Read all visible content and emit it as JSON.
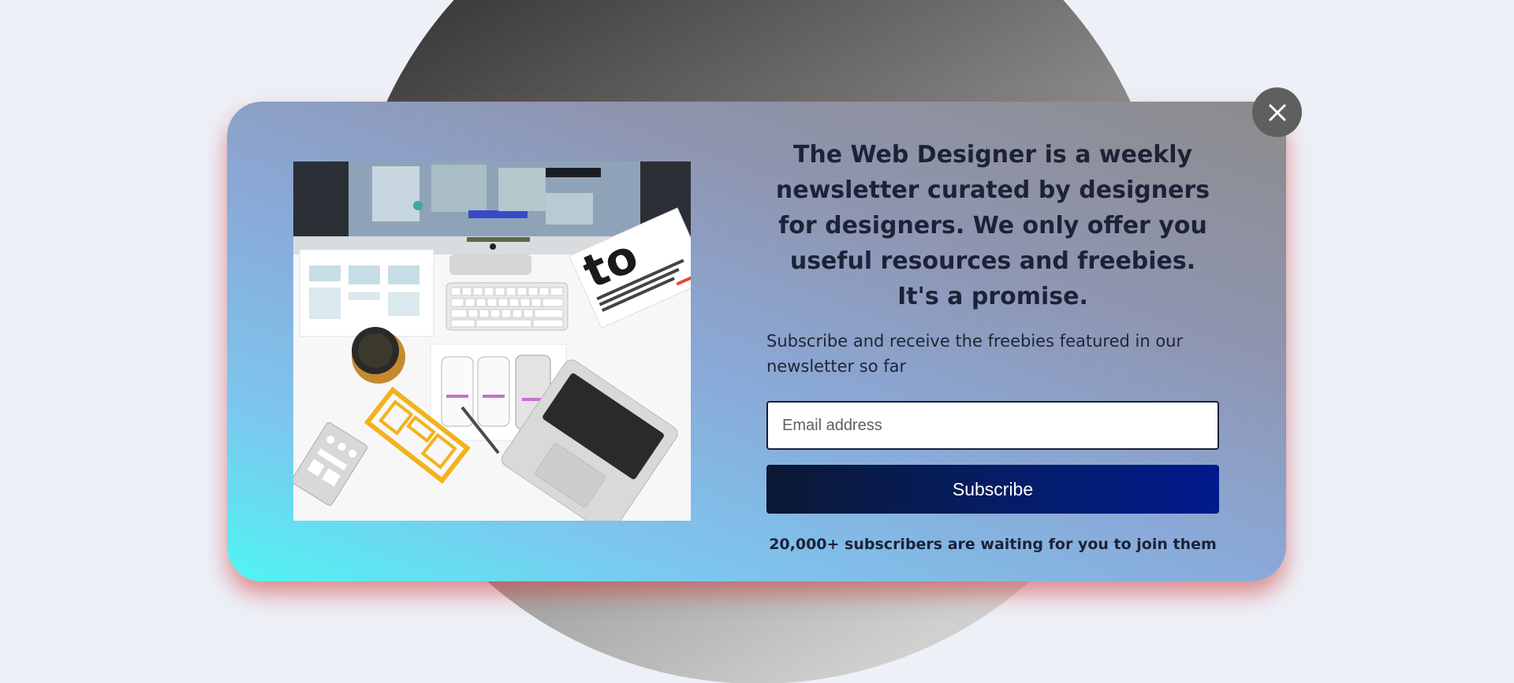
{
  "popup": {
    "headline": "The Web Designer is a weekly newsletter curated by designers for designers. We only offer you useful resources and freebies. It's a promise.",
    "subtext": "Subscribe and receive the freebies featured in our newsletter so far",
    "email_placeholder": "Email address",
    "subscribe_label": "Subscribe",
    "footnote": "20,000+ subscribers are waiting for you to join them",
    "close_icon": "close-icon",
    "image": "desk-workspace-photo"
  },
  "colors": {
    "page_background": "#edf0f7",
    "card_gradient_start": "#4ff5f2",
    "card_gradient_end": "#8c8c8c",
    "card_shadow": "#cd3c3c",
    "headline_text": "#1c2237",
    "button_gradient_start": "#0b1833",
    "button_gradient_end": "#011a8e",
    "close_button": "#5f5f5f"
  }
}
